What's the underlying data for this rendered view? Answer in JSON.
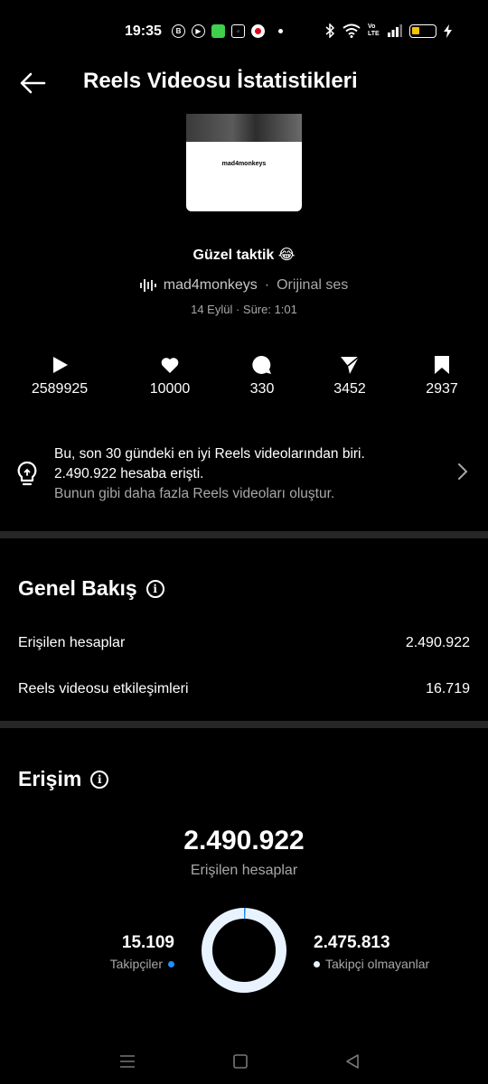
{
  "status_bar": {
    "time": "19:35",
    "left_icons": [
      "b-circle-icon",
      "maps-icon",
      "wechat-icon",
      "instagram-icon",
      "vodafone-icon"
    ],
    "network_label": "Vo LTE"
  },
  "header": {
    "title": "Reels Videosu İstatistikleri"
  },
  "reel": {
    "thumbnail_caption": "mad4monkeys",
    "title": "Güzel taktik 😂",
    "owner": "mad4monkeys",
    "audio_separator": "·",
    "audio": "Orijinal ses",
    "meta": "14 Eylül · Süre: 1:01"
  },
  "stats": [
    {
      "icon": "play-icon",
      "value": "2589925"
    },
    {
      "icon": "heart-icon",
      "value": "10000"
    },
    {
      "icon": "comment-icon",
      "value": "330"
    },
    {
      "icon": "share-icon",
      "value": "3452"
    },
    {
      "icon": "bookmark-icon",
      "value": "2937"
    }
  ],
  "insight": {
    "line1": "Bu, son 30 gündeki en iyi Reels videolarından biri.",
    "line2": "2.490.922 hesaba erişti.",
    "line3": "Bunun gibi daha fazla Reels videoları oluştur."
  },
  "overview": {
    "title": "Genel Bakış",
    "rows": [
      {
        "label": "Erişilen hesaplar",
        "value": "2.490.922"
      },
      {
        "label": "Reels videosu etkileşimleri",
        "value": "16.719"
      }
    ]
  },
  "reach": {
    "title": "Erişim",
    "total": "2.490.922",
    "total_label": "Erişilen hesaplar",
    "followers": {
      "value": "15.109",
      "label": "Takipçiler",
      "color": "#1e90ff"
    },
    "non_followers": {
      "value": "2.475.813",
      "label": "Takipçi olmayanlar",
      "color": "#e8f3ff"
    },
    "followers_fraction": 0.0061
  },
  "colors": {
    "background": "#000000",
    "divider": "#262626",
    "secondary_text": "#a8a8a8"
  }
}
